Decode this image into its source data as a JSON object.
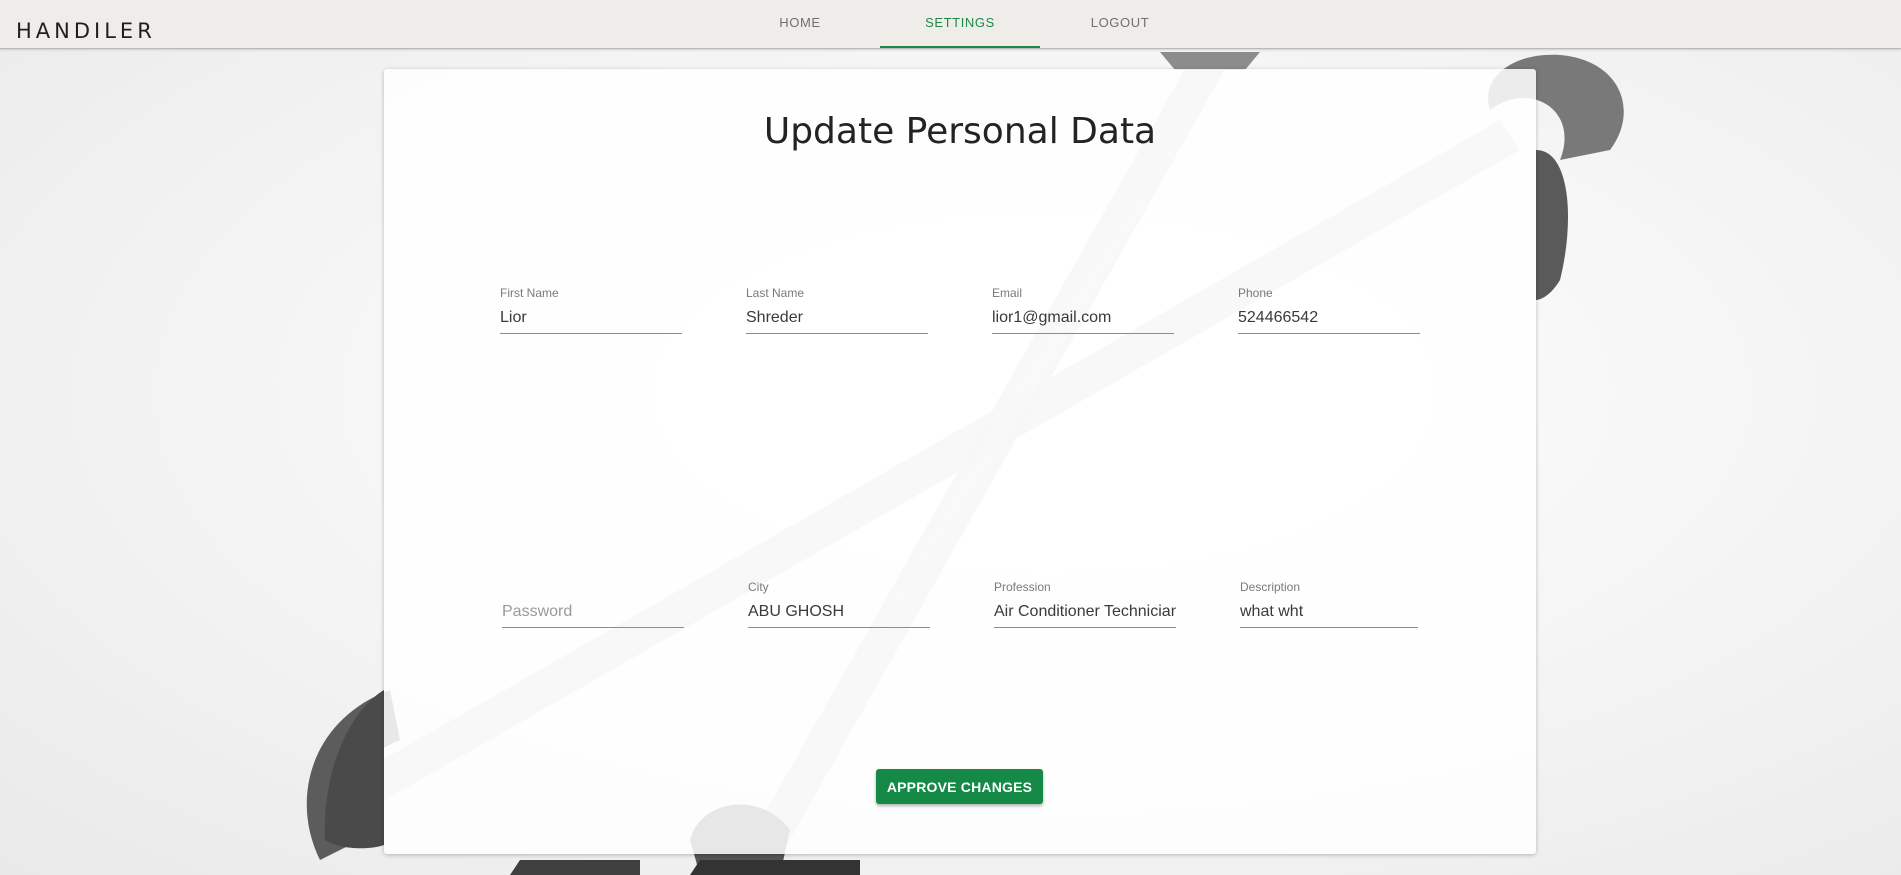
{
  "app": {
    "brand": "HANDILER"
  },
  "nav": {
    "tabs": [
      {
        "label": "HOME",
        "active": false
      },
      {
        "label": "SETTINGS",
        "active": true
      },
      {
        "label": "LOGOUT",
        "active": false
      }
    ],
    "active_color": "#1e8a45"
  },
  "form": {
    "title": "Update Personal Data",
    "fields": {
      "first_name": {
        "label": "First Name",
        "value": "Lior"
      },
      "last_name": {
        "label": "Last Name",
        "value": "Shreder"
      },
      "email": {
        "label": "Email",
        "value": "lior1@gmail.com"
      },
      "phone": {
        "label": "Phone",
        "value": "524466542"
      },
      "password": {
        "label": "",
        "value": "",
        "placeholder": "Password"
      },
      "city": {
        "label": "City",
        "value": "ABU GHOSH"
      },
      "profession": {
        "label": "Profession",
        "value": "Air Conditioner Technician"
      },
      "description": {
        "label": "Description",
        "value": "what wht"
      }
    },
    "submit_label": "APPROVE CHANGES",
    "submit_color": "#148a46"
  },
  "background": {
    "image": "wrench-icon"
  }
}
